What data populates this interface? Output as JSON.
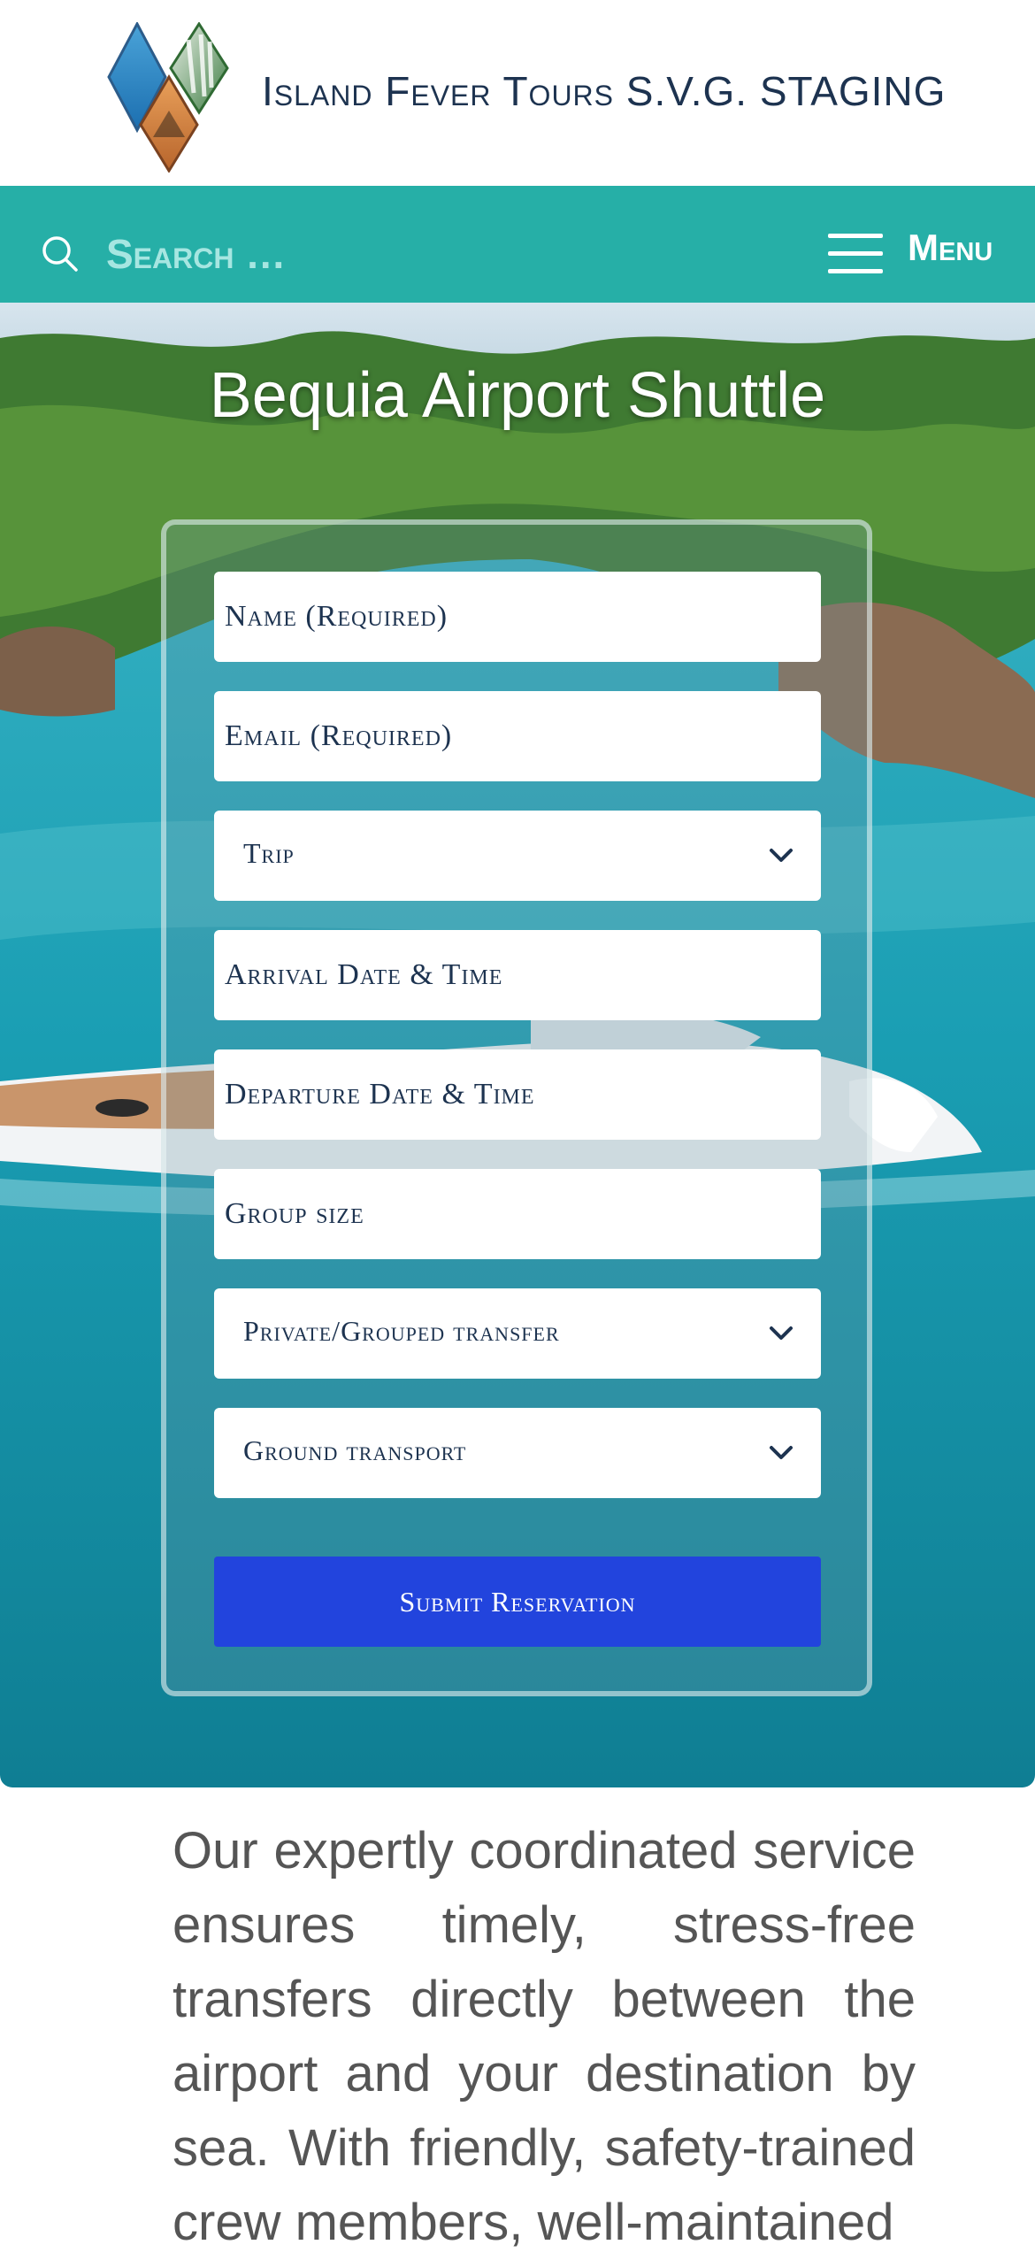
{
  "header": {
    "site_title": "Island Fever Tours S.V.G. STAGING"
  },
  "nav": {
    "search_placeholder": "Search …",
    "menu_label": "Menu"
  },
  "hero": {
    "title": "Bequia Airport Shuttle"
  },
  "form": {
    "name_placeholder": "Name (Required)",
    "email_placeholder": "Email (Required)",
    "trip_selected": "Trip",
    "arrival_placeholder": "Arrival Date & Time",
    "departure_placeholder": "Departure Date & Time",
    "group_size_placeholder": "Group size",
    "transfer_selected": "Private/Grouped transfer",
    "ground_transport_selected": "Ground transport",
    "submit_label": "Submit Reservation"
  },
  "content": {
    "intro": "Our expertly coordinated service ensures timely, stress-free transfers directly between the airport and your destination by sea. With friendly, safety-trained crew members, well-maintained"
  },
  "colors": {
    "nav_bg": "#26afa7",
    "title_text": "#1d3350",
    "submit_bg": "#2244dd",
    "body_text": "#555555"
  },
  "icons": {
    "search": "search-icon",
    "menu": "hamburger-icon",
    "select": "chevron-down-icon"
  }
}
